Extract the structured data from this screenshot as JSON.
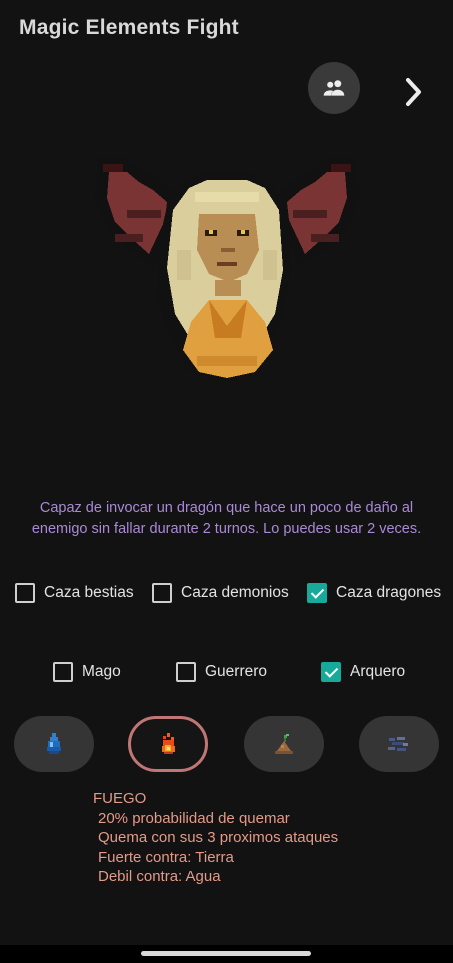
{
  "app": {
    "title": "Magic Elements Fight"
  },
  "toolbar": {
    "group_icon": "group-icon",
    "next_icon": "chevron-right-icon"
  },
  "character": {
    "description": "Capaz de invocar un dragón que hace un poco de daño al enemigo sin fallar durante 2 turnos. Lo puedes usar 2 veces."
  },
  "hunter_types": [
    {
      "label": "Caza bestias",
      "checked": false
    },
    {
      "label": "Caza demonios",
      "checked": false
    },
    {
      "label": "Caza dragones",
      "checked": true
    }
  ],
  "classes": [
    {
      "label": "Mago",
      "checked": false
    },
    {
      "label": "Guerrero",
      "checked": false
    },
    {
      "label": "Arquero",
      "checked": true
    }
  ],
  "elements": [
    {
      "icon": "water-drop-icon",
      "selected": false
    },
    {
      "icon": "fire-icon",
      "selected": true
    },
    {
      "icon": "earth-sprout-icon",
      "selected": false
    },
    {
      "icon": "air-icon",
      "selected": false
    }
  ],
  "element_info": {
    "name": "FUEGO",
    "line1": "20% probabilidad de quemar",
    "line2": "Quema con sus 3 proximos ataques",
    "line3": "Fuerte contra: Tierra",
    "line4": "Debil contra: Agua"
  },
  "colors": {
    "background": "#121212",
    "description_text": "#a98ad6",
    "info_text": "#e39a88",
    "accent_teal": "#17a99a",
    "selected_ring": "#c17676"
  }
}
